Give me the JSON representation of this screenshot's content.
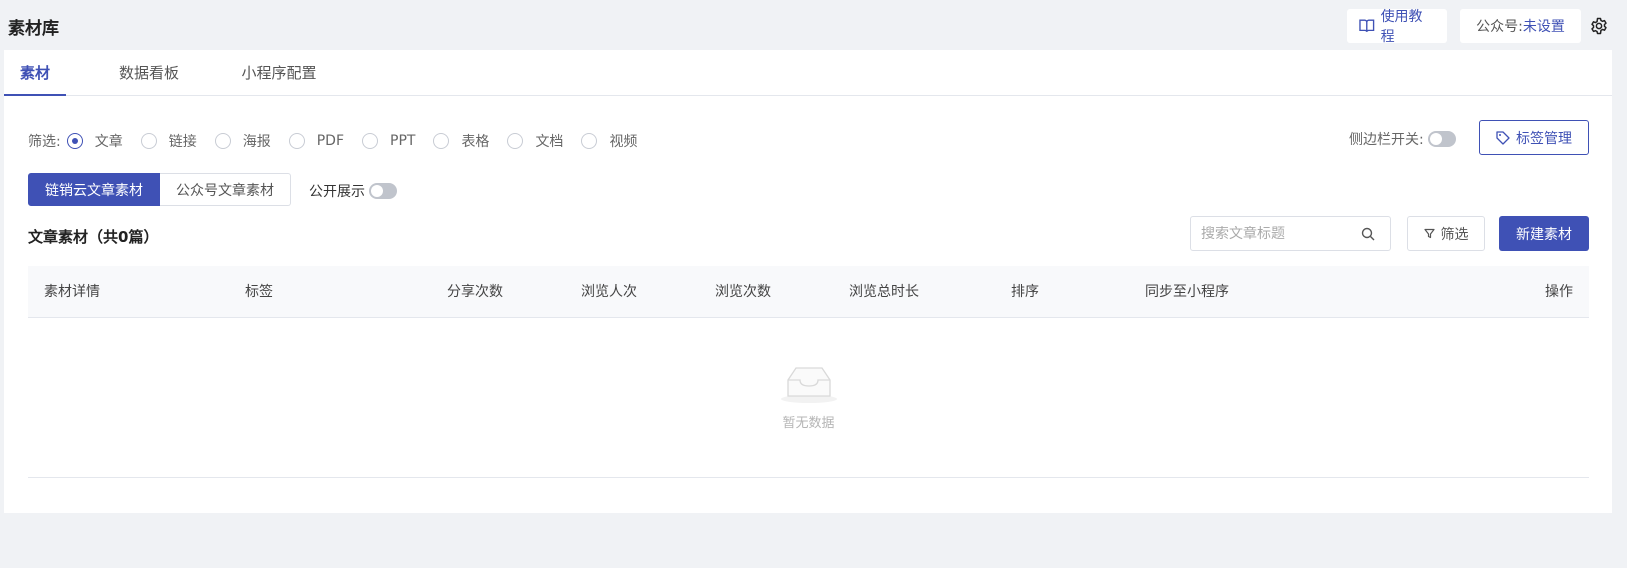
{
  "header": {
    "title": "素材库",
    "tutorial_label": "使用教程",
    "account_label": "公众号:",
    "account_value": "未设置"
  },
  "tabs": [
    {
      "label": "素材",
      "active": true
    },
    {
      "label": "数据看板",
      "active": false
    },
    {
      "label": "小程序配置",
      "active": false
    }
  ],
  "filter": {
    "label": "筛选:",
    "options": [
      {
        "label": "文章",
        "checked": true
      },
      {
        "label": "链接",
        "checked": false
      },
      {
        "label": "海报",
        "checked": false
      },
      {
        "label": "PDF",
        "checked": false
      },
      {
        "label": "PPT",
        "checked": false
      },
      {
        "label": "表格",
        "checked": false
      },
      {
        "label": "文档",
        "checked": false
      },
      {
        "label": "视频",
        "checked": false
      }
    ]
  },
  "sidebar_toggle_label": "侧边栏开关:",
  "tag_manage_label": "标签管理",
  "source_tabs": [
    "链销云文章素材",
    "公众号文章素材"
  ],
  "public_toggle_label": "公开展示",
  "section_title": "文章素材（共0篇）",
  "search": {
    "placeholder": "搜索文章标题"
  },
  "filter_button_label": "筛选",
  "new_button_label": "新建素材",
  "table": {
    "columns": [
      "素材详情",
      "标签",
      "分享次数",
      "浏览人次",
      "浏览次数",
      "浏览总时长",
      "排序",
      "同步至小程序",
      "操作"
    ],
    "empty_text": "暂无数据"
  },
  "colors": {
    "accent": "#3f51b5",
    "background": "#f0f2f5"
  }
}
